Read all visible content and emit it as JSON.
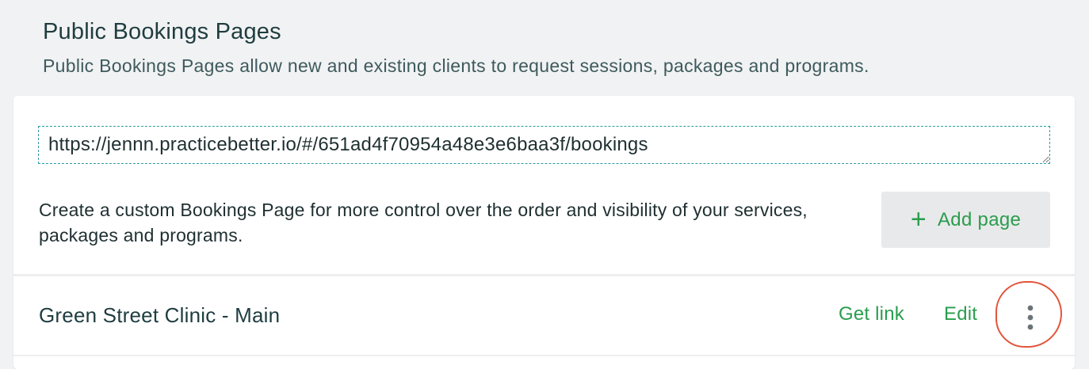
{
  "section": {
    "title": "Public Bookings Pages",
    "description": "Public Bookings Pages allow new and existing clients to request sessions, packages and programs."
  },
  "booking_url": {
    "value": "https://jennn.practicebetter.io/#/651ad4f70954a48e3e6baa3f/bookings"
  },
  "custom_page": {
    "text": "Create a custom Bookings Page for more control over the order and visibility of your services, packages and programs.",
    "add_button_label": "Add page",
    "add_button_icon": "plus-icon"
  },
  "pages": [
    {
      "name": "Green Street Clinic - Main",
      "get_link_label": "Get link",
      "edit_label": "Edit",
      "more_icon": "more-vertical-icon"
    }
  ],
  "colors": {
    "accent_green": "#2a9d4e",
    "focus_teal": "#2a9ba3",
    "highlight_red": "#e2553a",
    "title_text": "#1f3d40"
  }
}
